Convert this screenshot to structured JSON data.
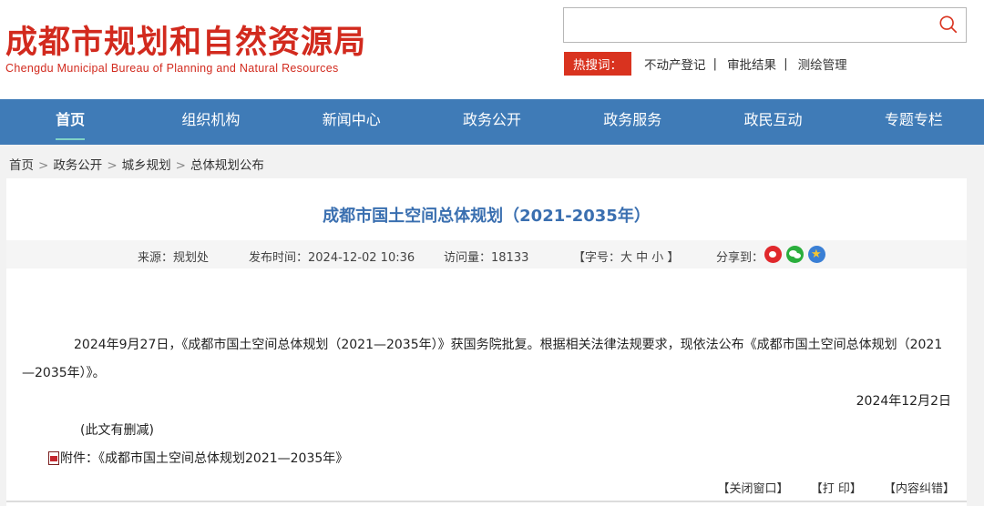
{
  "header": {
    "logo_cn": "成都市规划和自然资源局",
    "logo_en": "Chengdu Municipal Bureau of Planning and Natural Resources",
    "search_placeholder": "",
    "hot_label": "热搜词：",
    "hot_links": [
      "不动产登记",
      "审批结果",
      "测绘管理"
    ],
    "hot_sep": "|"
  },
  "nav": {
    "items": [
      "首页",
      "组织机构",
      "新闻中心",
      "政务公开",
      "政务服务",
      "政民互动",
      "专题专栏"
    ],
    "active_index": 0
  },
  "breadcrumb": {
    "items": [
      "首页",
      "政务公开",
      "城乡规划",
      "总体规划公布"
    ],
    "sep": ">"
  },
  "article": {
    "title": "成都市国土空间总体规划（2021-2035年）",
    "meta": {
      "source": "来源：规划处",
      "published": "发布时间：2024-12-02 10:36",
      "visits": "访问量：18133",
      "font_size": "【字号：大 中 小 】",
      "share_label": "分享到："
    },
    "share_icons": [
      "weibo-icon",
      "wechat-icon",
      "qzone-icon"
    ],
    "body": "2024年9月27日，《成都市国土空间总体规划（2021—2035年）》获国务院批复。根据相关法律法规要求，现依法公布《成都市国土空间总体规划（2021—2035年）》。",
    "date": "2024年12月2日",
    "note": "(此文有删减)",
    "attachment": "附件：《成都市国土空间总体规划2021—2035年》",
    "actions": [
      "【关闭窗口】",
      "【打 印】",
      "【内容纠错】"
    ]
  },
  "colors": {
    "brand_red": "#d22a1e",
    "nav_blue": "#3f7bb7",
    "title_blue": "#3a6fb0",
    "hot_tag_red": "#d9331f"
  }
}
